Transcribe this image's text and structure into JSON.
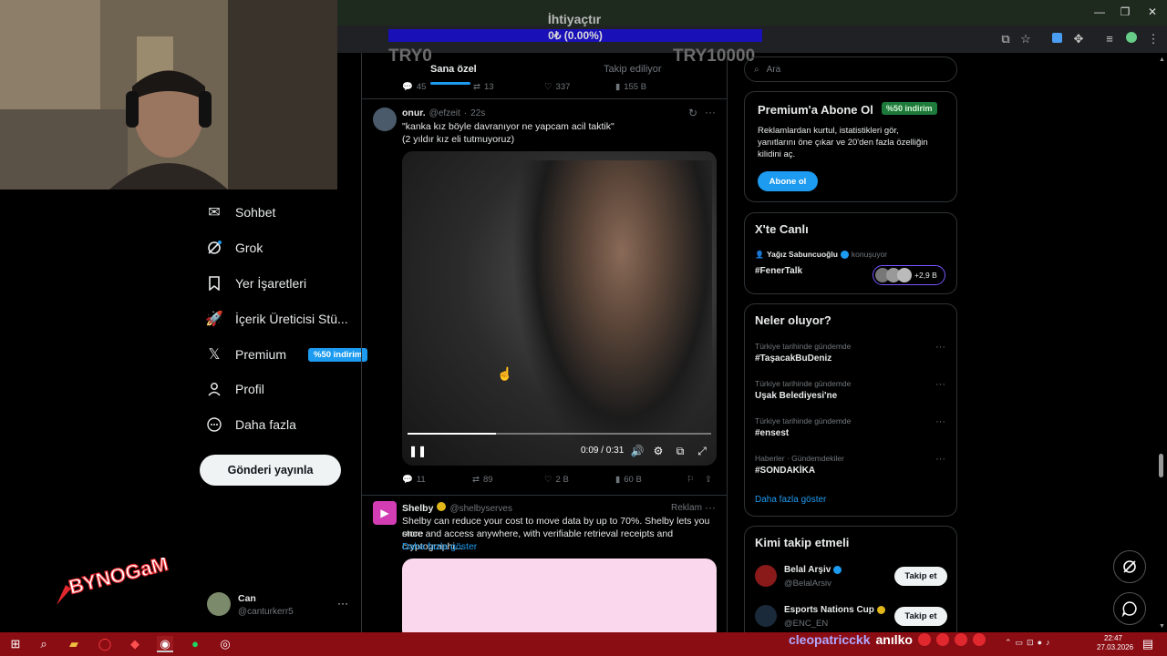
{
  "donation": {
    "title": "İhtiyaçtır",
    "value": "0₺ (0.00%)",
    "min": "TRY0",
    "max": "TRY10000"
  },
  "nav": {
    "items": [
      {
        "label": "Sohbet",
        "icon": "mail-icon"
      },
      {
        "label": "Grok",
        "icon": "grok-icon"
      },
      {
        "label": "Yer İşaretleri",
        "icon": "bookmark-icon"
      },
      {
        "label": "İçerik Üreticisi Stü...",
        "icon": "rocket-icon"
      },
      {
        "label": "Premium",
        "icon": "x-logo-icon"
      },
      {
        "label": "Profil",
        "icon": "person-icon"
      },
      {
        "label": "Daha fazla",
        "icon": "more-icon"
      }
    ],
    "premium_badge": "%50 indirim",
    "post_button": "Gönderi yayınla",
    "account": {
      "name": "Can",
      "handle": "@canturkerr5"
    }
  },
  "tabs": [
    "Sana özel",
    "Takip ediliyor"
  ],
  "prev_tweet_actions": [
    "45",
    "13",
    "337",
    "155 B"
  ],
  "tweet": {
    "name": "onur.",
    "handle": "@efzeit",
    "time": "22s",
    "line1": "\"kanka kız böyle davranıyor ne yapcam acil taktik\"",
    "line2": "(2 yıldır kız eli tutmuyoruz)",
    "video_time": "0:09 / 0:31",
    "video_progress": 0.29,
    "replies": "11",
    "retweets": "89",
    "likes": "2 B",
    "views": "60 B"
  },
  "ad": {
    "name": "Shelby",
    "handle": "@shelbyserves",
    "label": "Reklam",
    "line1": "Shelby can reduce your cost to move data by up to 70%. Shelby lets you store",
    "line2": "once and access anywhere, with verifiable retrieval receipts and cryptographi...",
    "more": "Daha fazla göster"
  },
  "sidebar": {
    "search_placeholder": "Ara",
    "premium": {
      "title": "Premium'a Abone Ol",
      "badge": "%50 indirim",
      "text1": "Reklamlardan kurtul, istatistikleri gör,",
      "text2": "yanıtlarını öne çıkar ve 20'den fazla özelliğin",
      "text3": "kilidini aç.",
      "button": "Abone ol"
    },
    "live": {
      "title": "X'te Canlı",
      "host": "Yağız Sabuncuoğlu",
      "status": "konuşuyor",
      "topic": "#FenerTalk",
      "count": "+2,9 B"
    },
    "trends": {
      "title": "Neler oluyor?",
      "items": [
        {
          "meta": "Türkiye tarihinde gündemde",
          "name": "#TaşacakBuDeniz"
        },
        {
          "meta": "Türkiye tarihinde gündemde",
          "name": "Uşak Belediyesi'ne"
        },
        {
          "meta": "Türkiye tarihinde gündemde",
          "name": "#ensest"
        },
        {
          "meta": "Haberler · Gündemdekiler",
          "name": "#SONDAKİKA"
        }
      ],
      "more": "Daha fazla göster"
    },
    "follow": {
      "title": "Kimi takip etmeli",
      "items": [
        {
          "name": "Belal Arşiv",
          "handle": "@BelalArsiv",
          "button": "Takip et"
        },
        {
          "name": "Esports Nations Cup",
          "handle": "@ENC_EN",
          "button": "Takip et"
        }
      ]
    }
  },
  "overlay": {
    "logo": "BYNOGaM",
    "chat_user": "cleopatricckk",
    "chat_msg": "anılko"
  },
  "taskbar": {
    "time": "22:47",
    "date": "27.03.2026"
  },
  "colors": {
    "accent": "#1d9bf0",
    "premium_badge": "#1d7a3b",
    "taskbar": "#8a0d14",
    "donation_bar": "#1a10b8"
  }
}
